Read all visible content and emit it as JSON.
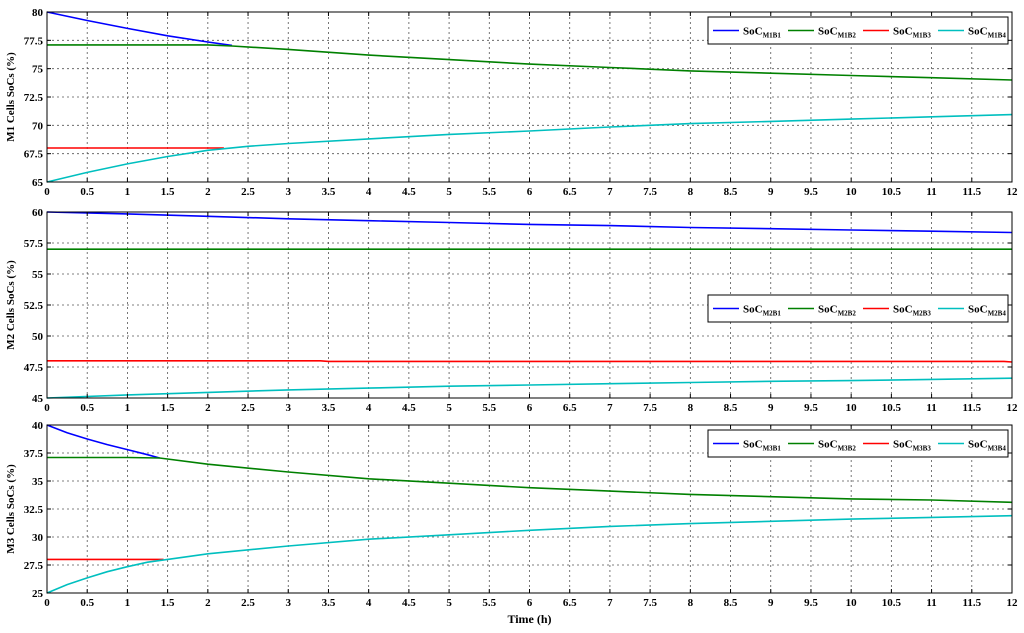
{
  "chart_data": [
    {
      "type": "line",
      "ylabel": "M1 Cells SoCs (%)",
      "xlabel": "",
      "xlim": [
        0,
        12
      ],
      "ylim": [
        65,
        80
      ],
      "x_ticks": [
        "0",
        "0.5",
        "1",
        "1.5",
        "2",
        "2.5",
        "3",
        "3.5",
        "4",
        "4.5",
        "5",
        "5.5",
        "6",
        "6.5",
        "7",
        "7.5",
        "8",
        "8.5",
        "9",
        "9.5",
        "10",
        "10.5",
        "11",
        "11.5",
        "12"
      ],
      "y_ticks": [
        "80",
        "77.5",
        "75",
        "72.5",
        "70",
        "67.5",
        "65"
      ],
      "y_tick_values": [
        80,
        77.5,
        75,
        72.5,
        70,
        67.5,
        65
      ],
      "grid": true,
      "legend_position": "top-right",
      "series": [
        {
          "name": "SoC",
          "sub": "M1B1",
          "color": "#0000ff",
          "x": [
            0,
            0.5,
            1,
            1.5,
            2,
            2.3
          ],
          "values": [
            80,
            79.25,
            78.55,
            77.9,
            77.35,
            77.05
          ]
        },
        {
          "name": "SoC",
          "sub": "M1B2",
          "color": "#008000",
          "x": [
            0,
            1,
            2,
            2.3,
            3,
            4,
            5,
            6,
            7,
            8,
            9,
            10,
            11,
            12
          ],
          "values": [
            77.1,
            77.1,
            77.1,
            77.0,
            76.7,
            76.2,
            75.8,
            75.4,
            75.1,
            74.8,
            74.6,
            74.4,
            74.2,
            74.0
          ]
        },
        {
          "name": "SoC",
          "sub": "M1B3",
          "color": "#ff0000",
          "x": [
            0,
            1,
            2,
            2.2
          ],
          "values": [
            68,
            68,
            68,
            68
          ]
        },
        {
          "name": "SoC",
          "sub": "M1B4",
          "color": "#00bfbf",
          "x": [
            0,
            0.5,
            1,
            1.5,
            2,
            2.5,
            3,
            4,
            5,
            6,
            7,
            8,
            9,
            10,
            11,
            12
          ],
          "values": [
            65,
            65.85,
            66.6,
            67.25,
            67.8,
            68.15,
            68.4,
            68.8,
            69.2,
            69.5,
            69.85,
            70.15,
            70.35,
            70.55,
            70.75,
            70.95
          ]
        }
      ]
    },
    {
      "type": "line",
      "ylabel": "M2 Cells SoCs (%)",
      "xlabel": "",
      "xlim": [
        0,
        12
      ],
      "ylim": [
        45,
        60
      ],
      "x_ticks": [
        "0",
        "0.5",
        "1",
        "1.5",
        "2",
        "2.5",
        "3",
        "3.5",
        "4",
        "4.5",
        "5",
        "5.5",
        "6",
        "6.5",
        "7",
        "7.5",
        "8",
        "8.5",
        "9",
        "9.5",
        "10",
        "10.5",
        "11",
        "11.5",
        "12"
      ],
      "y_ticks": [
        "60",
        "57.5",
        "55",
        "52.5",
        "50",
        "47.5",
        "45"
      ],
      "y_tick_values": [
        60,
        57.5,
        55,
        52.5,
        50,
        47.5,
        45
      ],
      "grid": true,
      "legend_position": "center-right",
      "series": [
        {
          "name": "SoC",
          "sub": "M2B1",
          "color": "#0000ff",
          "x": [
            0,
            1,
            2,
            3,
            4,
            5,
            6,
            7,
            8,
            9,
            10,
            11,
            12
          ],
          "values": [
            60,
            59.85,
            59.65,
            59.45,
            59.3,
            59.15,
            59.0,
            58.9,
            58.75,
            58.65,
            58.55,
            58.45,
            58.35
          ]
        },
        {
          "name": "SoC",
          "sub": "M2B2",
          "color": "#008000",
          "x": [
            0,
            12
          ],
          "values": [
            57,
            57
          ]
        },
        {
          "name": "SoC",
          "sub": "M2B3",
          "color": "#ff0000",
          "x": [
            0,
            3.4,
            3.5,
            11.9,
            12
          ],
          "values": [
            48,
            48,
            47.95,
            47.95,
            47.9
          ]
        },
        {
          "name": "SoC",
          "sub": "M2B4",
          "color": "#00bfbf",
          "x": [
            0,
            1,
            2,
            3,
            4,
            5,
            6,
            7,
            8,
            9,
            10,
            11,
            12
          ],
          "values": [
            45,
            45.25,
            45.45,
            45.65,
            45.8,
            45.95,
            46.05,
            46.15,
            46.25,
            46.35,
            46.4,
            46.5,
            46.6
          ]
        }
      ]
    },
    {
      "type": "line",
      "ylabel": "M3 Cells SoCs (%)",
      "xlabel": "Time (h)",
      "xlim": [
        0,
        12
      ],
      "ylim": [
        25,
        40
      ],
      "x_ticks": [
        "0",
        "0.5",
        "1",
        "1.5",
        "2",
        "2.5",
        "3",
        "3.5",
        "4",
        "4.5",
        "5",
        "5.5",
        "6",
        "6.5",
        "7",
        "7.5",
        "8",
        "8.5",
        "9",
        "9.5",
        "10",
        "10.5",
        "11",
        "11.5",
        "12"
      ],
      "y_ticks": [
        "40",
        "37.5",
        "35",
        "32.5",
        "30",
        "27.5",
        "25"
      ],
      "y_tick_values": [
        40,
        37.5,
        35,
        32.5,
        30,
        27.5,
        25
      ],
      "grid": true,
      "legend_position": "top-right",
      "series": [
        {
          "name": "SoC",
          "sub": "M3B1",
          "color": "#0000ff",
          "x": [
            0,
            0.25,
            0.5,
            0.75,
            1,
            1.25,
            1.4
          ],
          "values": [
            40,
            39.3,
            38.75,
            38.25,
            37.8,
            37.35,
            37.05
          ]
        },
        {
          "name": "SoC",
          "sub": "M3B2",
          "color": "#008000",
          "x": [
            0,
            1,
            1.4,
            2,
            3,
            4,
            5,
            6,
            7,
            8,
            9,
            10,
            11,
            12
          ],
          "values": [
            37.1,
            37.1,
            37.05,
            36.5,
            35.8,
            35.2,
            34.8,
            34.4,
            34.1,
            33.8,
            33.6,
            33.4,
            33.3,
            33.1
          ]
        },
        {
          "name": "SoC",
          "sub": "M3B3",
          "color": "#ff0000",
          "x": [
            0,
            1,
            1.45
          ],
          "values": [
            28,
            28,
            28
          ]
        },
        {
          "name": "SoC",
          "sub": "M3B4",
          "color": "#00bfbf",
          "x": [
            0,
            0.25,
            0.5,
            0.75,
            1,
            1.25,
            1.5,
            2,
            3,
            4,
            5,
            6,
            7,
            8,
            9,
            10,
            11,
            12
          ],
          "values": [
            25,
            25.75,
            26.35,
            26.9,
            27.35,
            27.75,
            28.0,
            28.5,
            29.2,
            29.8,
            30.2,
            30.6,
            30.95,
            31.2,
            31.4,
            31.6,
            31.75,
            31.9
          ]
        }
      ]
    }
  ]
}
